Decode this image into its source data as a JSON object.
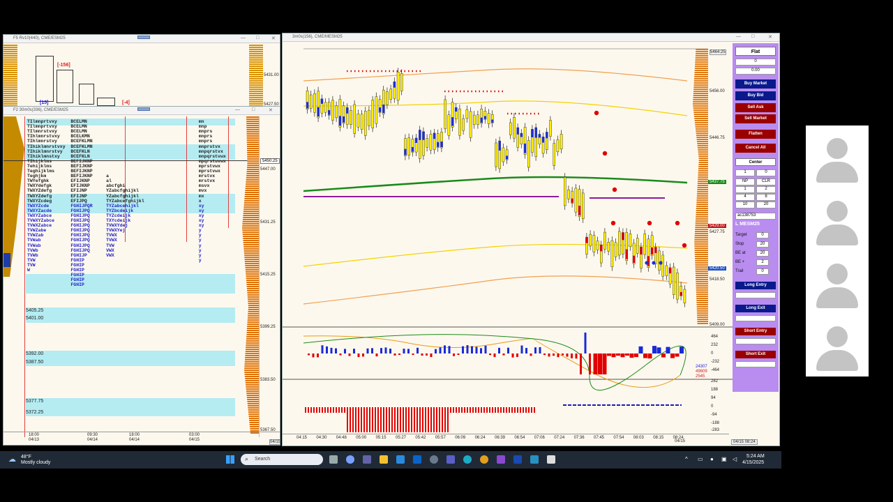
{
  "windows": {
    "f5": {
      "title": "F5 Rv10(440), CME/ESM25",
      "labels": [
        "[15]",
        "[-156]",
        "[-4]"
      ],
      "prices": [
        "5431.00",
        "5427.50"
      ]
    },
    "f2": {
      "title": "F2 30m0s(336), CME/ESM25",
      "prices": [
        "5447.00",
        "5431.25",
        "5415.25",
        "5399.25",
        "5383.50",
        "5367.50"
      ],
      "tag": "5450.25",
      "levels": [
        "5405.25",
        "5401.00",
        "5392.00",
        "5387.50",
        "5377.75",
        "5372.25"
      ],
      "xaxis": [
        {
          "t": "18:00",
          "d": "04/13"
        },
        {
          "t": "09:30",
          "d": "04/14"
        },
        {
          "t": "18:00",
          "d": "04/14"
        },
        {
          "t": "03:00",
          "d": "04/15"
        }
      ],
      "corner": "04/15",
      "rows": [
        "TIlmnprtvxy     BCELMN                                         mn",
        "TIlmnprtvxy     BCELMN                                         mnp",
        "TIlmnrstvxy     BCELMN                                         mnprs",
        "TIhlmnrstvxy    BCELKMN                                        mnprs",
        "TIhlmnrstvy     BCEFKLMN                                       mnprs",
        "TIhiklmnrstvxy  BCEFKLMN                                       mnprstvx",
        "TIhiklmnrstvy   BCEFKLN                                        mnpqrstvx",
        "TIhiklmnstxy    BCEFKLN                                        mnpqrstvwx",
        "TIhijklms       BEFIJKNP                                       mpqrstuvwx",
        "Tehijklms       BEFIJKNP                                       mprstvwx",
        "Teghijklms      BEFIJKNP                                       mprstvwx",
        "Teghjkm         BEFIJKNP     a                                 mrstvx",
        "TWYefghk        EFIJKNP      al                                mrstvx",
        "TWXYdefgk       EFIJKNP      abcfghi                           msvx",
        "TWXYZdefg       EFIJNP       YZabcfghijkl                      mvx",
        "TWXYZdefg       EFIJNP       YZabcfghijkl                      mx",
        "TWXYZcdeg       EFIJPQ       TYZabcefghijkl                    x",
        "TWXYZcde        FGHIJPQR     TYZabcehijkl                      xy",
        "TWXYZacde       FGHIJPQ      TYZbcdeijk                        xy",
        "TWXYZabce       FGHIJPQ      TYZcdeijk                         xy",
        "TVWXYZabce      FGHIJPQ      TXYcdeijk                         xy",
        "TVWXZabce       FGHIJPQ      TVWXYdej                          xy",
        "TVWZabe         FGHIJPQ      TVWXYej                           y",
        "TVWZab          FGHIJPQ      TVWX                              y",
        "TVWab           FGHIJPQ      TVWX                              y",
        "TVWab           FGHIJPQ      TVW                               y",
        "TVWb            FGHIJPQ      VWX                               y",
        "TVWb            FGHIJP       VWX                               y",
        "TVW             FGHIP                                          y",
        "TVW             FGHIP",
        "W               FGHIP",
        "                FGHIP",
        "                FGHIP",
        "                FGHIP"
      ]
    },
    "main": {
      "title": "3m0s(156), CME/MESM25",
      "prices": [
        "5464.25",
        "5456.00",
        "5446.75",
        "5437.75",
        "5427.75",
        "5418.50",
        "5409.00"
      ],
      "tags": {
        "green": "5437.75",
        "red": "5429.00",
        "blue": "5420.50"
      },
      "xaxis": [
        "04:15",
        "04:30",
        "04:48",
        "05:00",
        "05:15",
        "05:27",
        "05:42",
        "05:57",
        "06:09",
        "06:24",
        "06:39",
        "06:54",
        "07:06",
        "07:24",
        "07:36",
        "07:45",
        "07:54",
        "08:03",
        "08:15",
        "08:24"
      ],
      "xaxis_date": "04/15",
      "corner": "04/15 08:24",
      "osc1": [
        "464",
        "232",
        "0",
        "-232",
        "-464"
      ],
      "osc1_vals": [
        "24307",
        "49809",
        "2545"
      ],
      "osc2": [
        "282",
        "188",
        "94",
        "0",
        "-94",
        "-188",
        "-283"
      ]
    }
  },
  "panel": {
    "position": "Flat",
    "qty": "0",
    "pnl": "0.00",
    "buttons": [
      "Buy Market",
      "Buy Bid",
      "Sell Ask",
      "Sell Market",
      "Flatten",
      "Cancel All"
    ],
    "center": "Center",
    "qty_input": "1",
    "qty_zero": "0",
    "grid": [
      "NP",
      "CLR",
      "1",
      "2",
      "4",
      "8",
      "10",
      "20"
    ],
    "account": "ac138753",
    "symbol": "L MESM25",
    "fields": [
      {
        "label": "Target",
        "v": "0"
      },
      {
        "label": "Stop",
        "v": "20"
      },
      {
        "label": "BE at",
        "v": "20"
      },
      {
        "label": "BE +",
        "v": "2"
      },
      {
        "label": "Trail",
        "v": "0"
      }
    ],
    "entries": [
      "Long Entry",
      "Long Exit",
      "Short Entry",
      "Short Exit"
    ]
  },
  "taskbar": {
    "temp": "48°F",
    "weather": "Mostly cloudy",
    "search": "Search",
    "time": "5:24 AM",
    "date": "4/15/2025"
  },
  "colors": {
    "buy": "#0a1a8c",
    "sell": "#9a0000",
    "panel": "#b98cf0",
    "band": "#b4ecf2"
  }
}
